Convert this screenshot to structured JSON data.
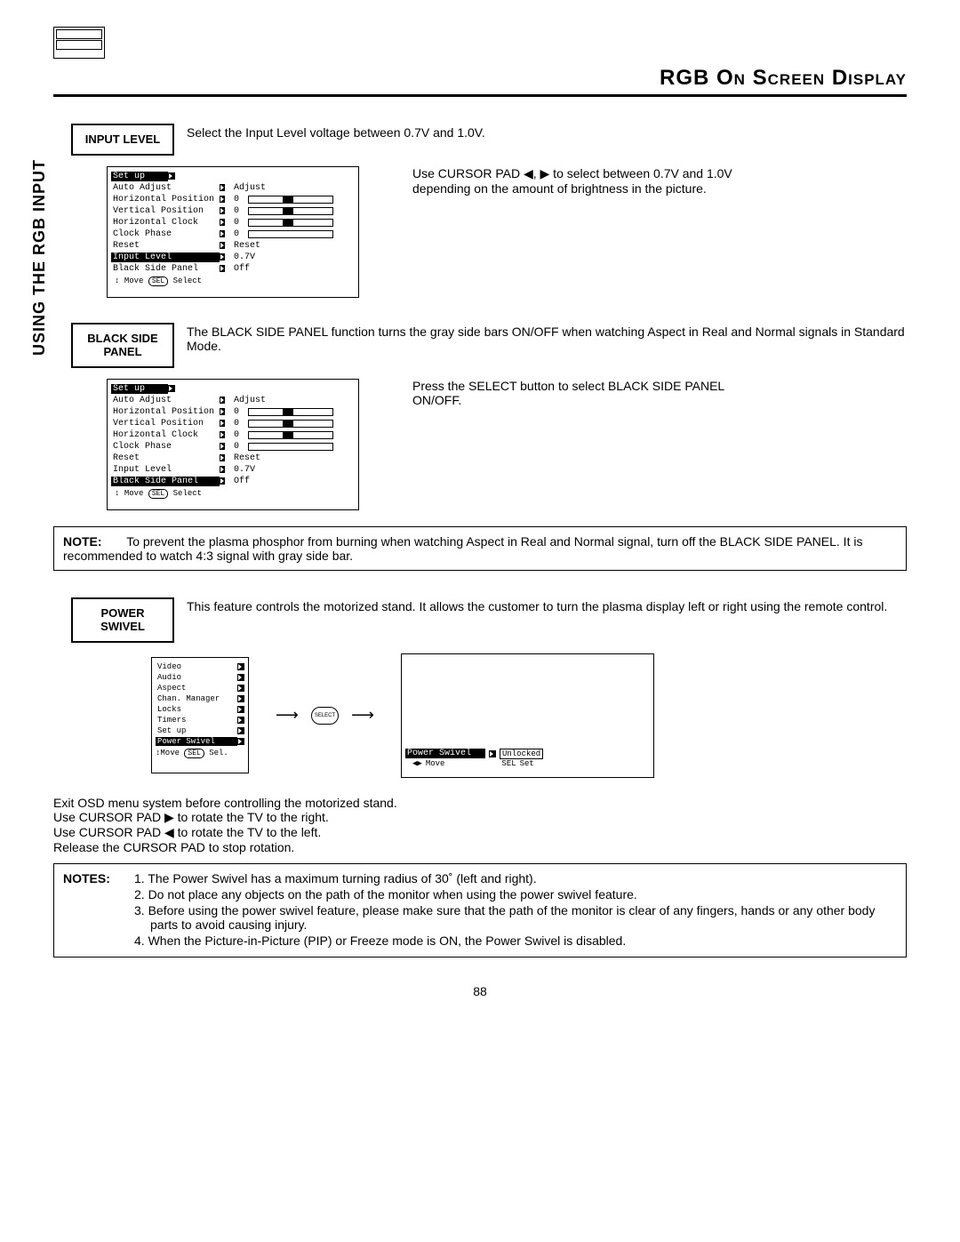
{
  "header_title": "RGB On Screen Display",
  "side_tab": "USING THE RGB INPUT",
  "page_number": "88",
  "input_level": {
    "label": "INPUT LEVEL",
    "desc": "Select the Input Level voltage between 0.7V and 1.0V.",
    "side": "Use CURSOR PAD ◀, ▶ to select between 0.7V and 1.0V depending on the amount of brightness in the picture."
  },
  "black_side": {
    "label": "BLACK SIDE PANEL",
    "desc": "The BLACK SIDE PANEL function turns the gray side bars ON/OFF when watching Aspect in Real and Normal signals in Standard Mode.",
    "side": "Press the SELECT button to select BLACK SIDE PANEL ON/OFF."
  },
  "note1": {
    "label": "NOTE:",
    "text": "To prevent the plasma phosphor from burning when watching Aspect in Real and Normal signal, turn off the BLACK SIDE PANEL.  It is recommended to watch 4:3 signal with gray side bar."
  },
  "power_swivel": {
    "label": "POWER SWIVEL",
    "desc": "This feature controls the motorized stand.  It allows the customer to turn the plasma display left or right using the remote control."
  },
  "instructions": {
    "l1": "Exit OSD menu system before controlling the motorized stand.",
    "l2": "Use CURSOR PAD ▶ to rotate the TV to the right.",
    "l3": "Use CURSOR PAD ◀ to rotate the TV to the left.",
    "l4": "Release the CURSOR PAD to stop rotation."
  },
  "notes2": {
    "label": "NOTES:",
    "items": [
      "1.  The Power Swivel has a maximum turning radius of 30˚ (left and right).",
      "2.  Do not place any objects on the path of the monitor when using the power swivel feature.",
      "3.  Before using the power swivel feature, please make sure that the path of the monitor is clear of any fingers, hands or any other body parts to avoid causing injury.",
      "4.  When the Picture-in-Picture (PIP) or Freeze mode is ON, the Power Swivel is disabled."
    ]
  },
  "osd_setup": {
    "title": "Set up",
    "items": [
      "Auto Adjust",
      "Horizontal Position",
      "Vertical Position",
      "Horizontal Clock",
      "Clock Phase",
      "Reset",
      "Input Level",
      "Black Side Panel"
    ],
    "values": [
      "Adjust",
      "0",
      "0",
      "0",
      "0",
      "Reset",
      "0.7V",
      "Off"
    ],
    "foot_move": "Move",
    "foot_sel": "SEL",
    "foot_select": "Select"
  },
  "main_menu": {
    "items": [
      "Video",
      "Audio",
      "Aspect",
      "Chan. Manager",
      "Locks",
      "Timers",
      "Set up",
      "Power Swivel"
    ],
    "foot_move": "Move",
    "foot_sel": "SEL",
    "foot_select": "Sel."
  },
  "select_btn": "SELECT",
  "status": {
    "name": "Power Swivel",
    "value": "Unlocked",
    "move": "Move",
    "sel": "SEL",
    "set": "Set"
  }
}
